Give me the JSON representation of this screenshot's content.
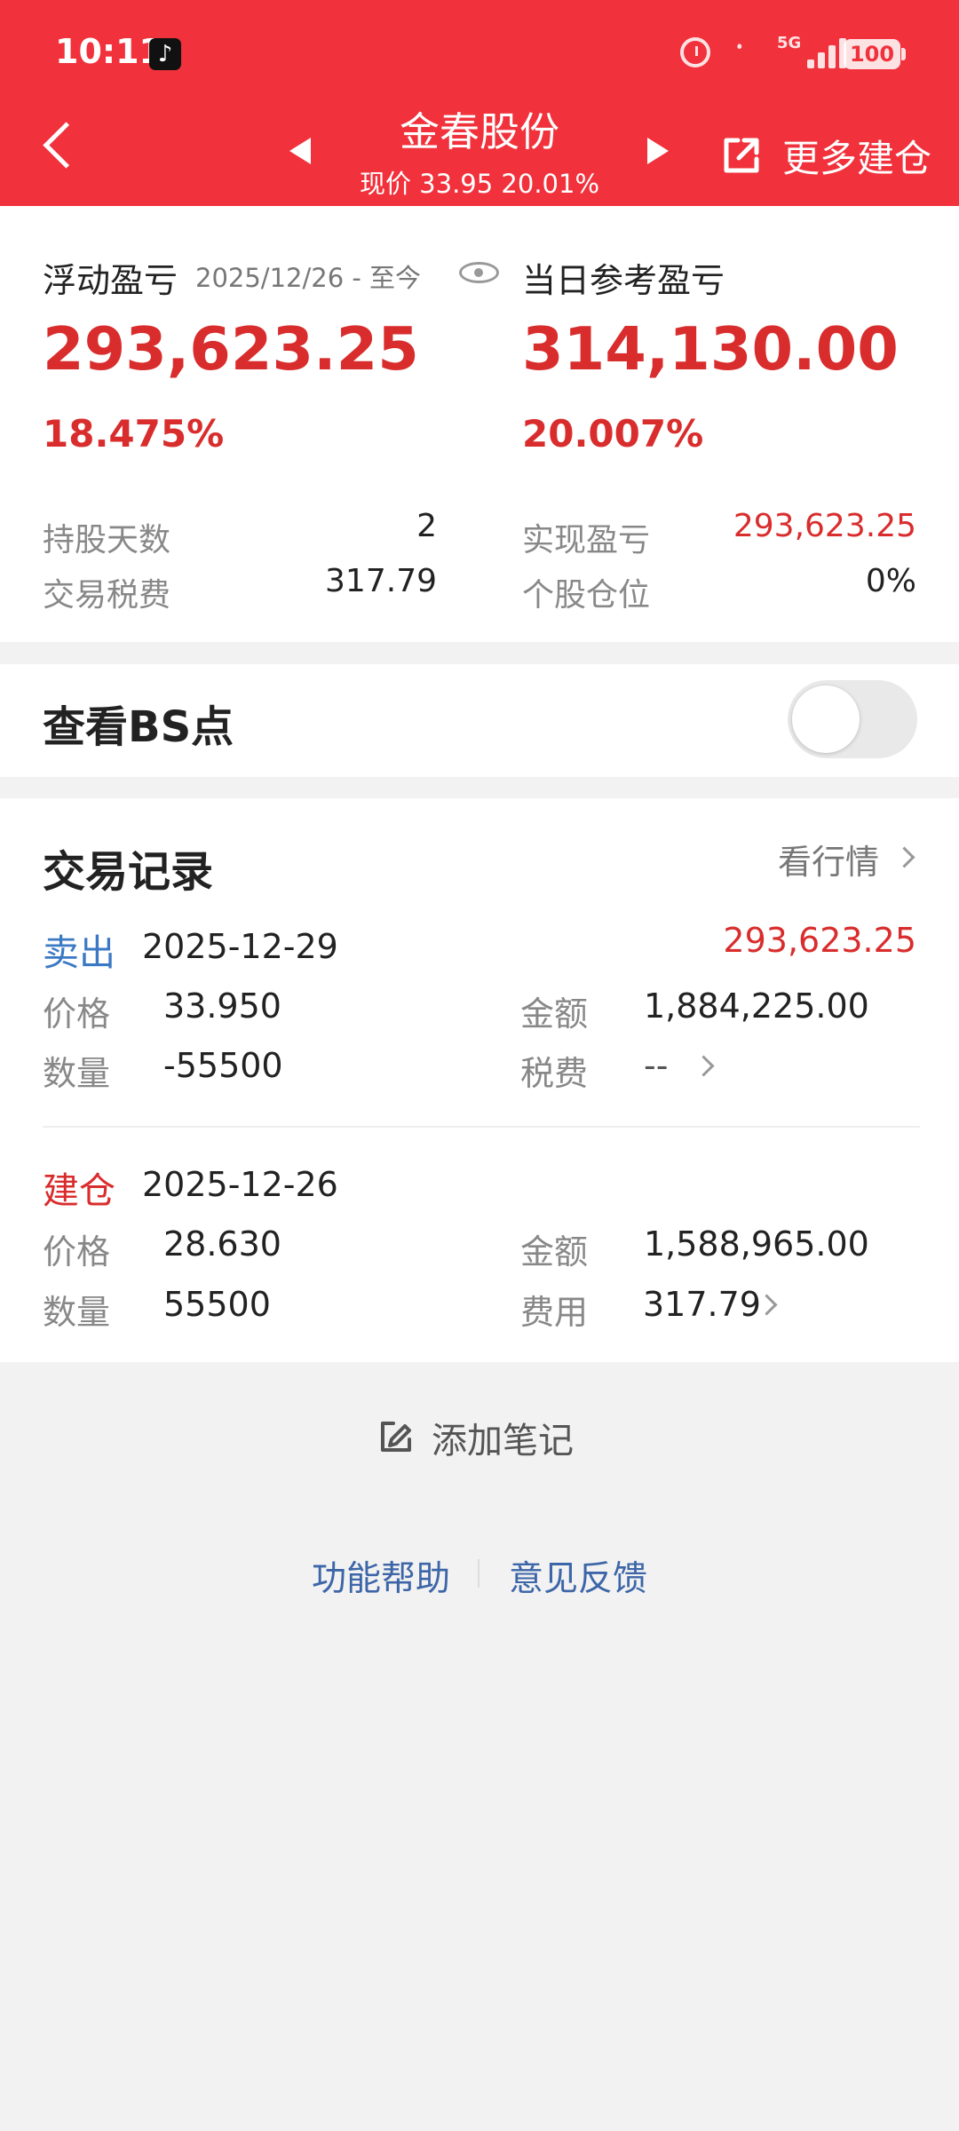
{
  "status_bar": {
    "time": "10:11",
    "network": "5G",
    "battery": "100",
    "icons": [
      "tiktok-icon",
      "alarm-icon",
      "bluetooth-icon",
      "signal-icon",
      "battery-icon"
    ]
  },
  "header": {
    "stock_name": "金春股份",
    "price_line": "现价 33.95 20.01%",
    "more_build": "更多建仓"
  },
  "summary": {
    "floating_pl_label": "浮动盈亏",
    "date_range": "2025/12/26 - 至今",
    "daily_reference_label": "当日参考盈亏",
    "floating_pl_value": "293,623.25",
    "floating_pl_pct": "18.475%",
    "daily_reference_value": "314,130.00",
    "daily_reference_pct": "20.007%",
    "rows": [
      {
        "label": "持股天数",
        "value": "2"
      },
      {
        "label": "交易税费",
        "value": "317.79"
      },
      {
        "label": "实现盈亏",
        "value": "293,623.25"
      },
      {
        "label": "个股仓位",
        "value": "0%"
      }
    ]
  },
  "bs": {
    "title": "查看BS点",
    "enabled": false
  },
  "trades": {
    "title": "交易记录",
    "market_link": "看行情",
    "records": [
      {
        "type": "卖出",
        "date": "2025-12-29",
        "profit": "293,623.25",
        "price_label": "价格",
        "price": "33.950",
        "amount_label": "金额",
        "amount": "1,884,225.00",
        "quantity_label": "数量",
        "quantity": "-55500",
        "fee_label": "税费",
        "fee": "--"
      },
      {
        "type": "建仓",
        "date": "2025-12-26",
        "price_label": "价格",
        "price": "28.630",
        "amount_label": "金额",
        "amount": "1,588,965.00",
        "quantity_label": "数量",
        "quantity": "55500",
        "fee_label": "费用",
        "fee": "317.79"
      }
    ]
  },
  "footer": {
    "add_note": "添加笔记",
    "help": "功能帮助",
    "feedback": "意见反馈"
  }
}
